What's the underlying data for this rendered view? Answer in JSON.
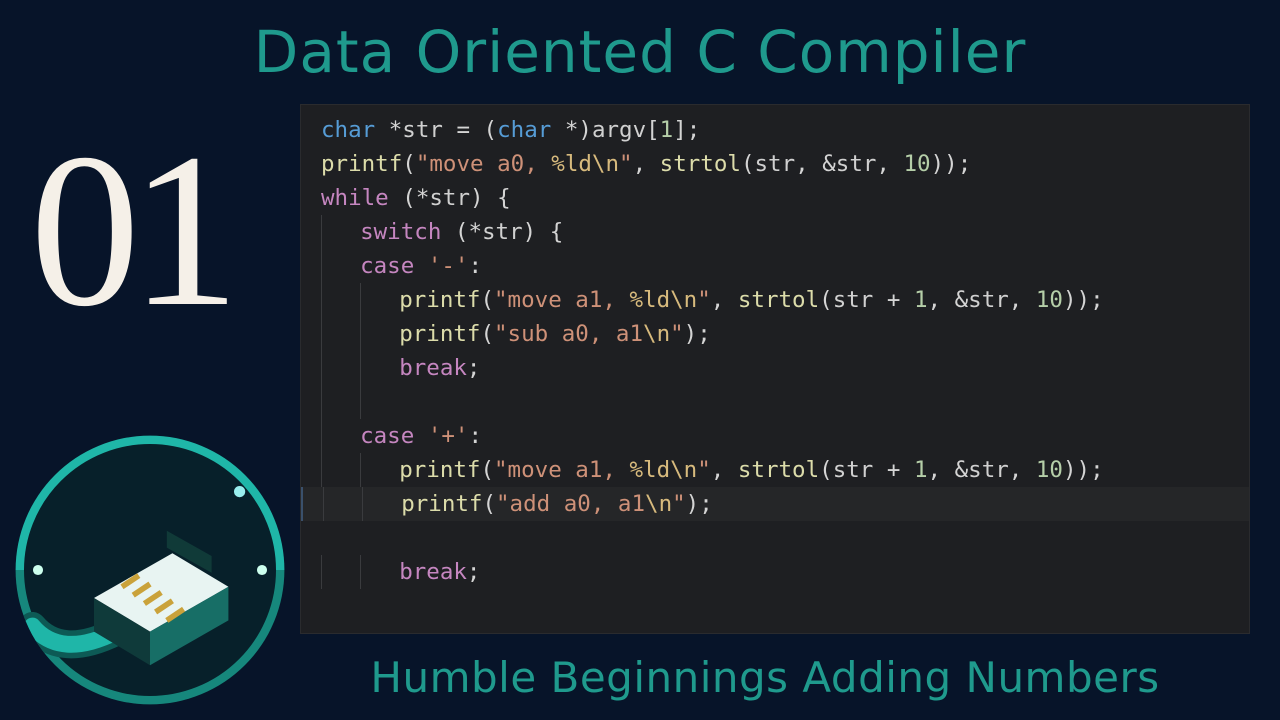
{
  "title": "Data Oriented C Compiler",
  "subtitle": "Humble Beginnings Adding Numbers",
  "episode": "01",
  "logo": {
    "name": "channel-logo"
  },
  "colors": {
    "bg": "#071429",
    "accent": "#1f9a8d",
    "code_bg": "#1e1f22"
  },
  "code": {
    "language": "c",
    "lines": [
      {
        "indent": 0,
        "tokens": [
          {
            "t": "type",
            "v": "char"
          },
          {
            "t": "op",
            "v": " *"
          },
          {
            "t": "id",
            "v": "str"
          },
          {
            "t": "op",
            "v": " = ("
          },
          {
            "t": "type",
            "v": "char"
          },
          {
            "t": "op",
            "v": " *)"
          },
          {
            "t": "id",
            "v": "argv"
          },
          {
            "t": "punc",
            "v": "["
          },
          {
            "t": "num",
            "v": "1"
          },
          {
            "t": "punc",
            "v": "];"
          }
        ]
      },
      {
        "indent": 0,
        "tokens": [
          {
            "t": "fn",
            "v": "printf"
          },
          {
            "t": "punc",
            "v": "("
          },
          {
            "t": "str",
            "v": "\"move a0, "
          },
          {
            "t": "esc",
            "v": "%ld\\n"
          },
          {
            "t": "str",
            "v": "\""
          },
          {
            "t": "punc",
            "v": ", "
          },
          {
            "t": "fn",
            "v": "strtol"
          },
          {
            "t": "punc",
            "v": "("
          },
          {
            "t": "id",
            "v": "str"
          },
          {
            "t": "punc",
            "v": ", "
          },
          {
            "t": "amp",
            "v": "&"
          },
          {
            "t": "id",
            "v": "str"
          },
          {
            "t": "punc",
            "v": ", "
          },
          {
            "t": "num",
            "v": "10"
          },
          {
            "t": "punc",
            "v": "));"
          }
        ]
      },
      {
        "indent": 0,
        "tokens": [
          {
            "t": "kw",
            "v": "while"
          },
          {
            "t": "punc",
            "v": " (*"
          },
          {
            "t": "id",
            "v": "str"
          },
          {
            "t": "punc",
            "v": ") {"
          }
        ]
      },
      {
        "indent": 1,
        "tokens": [
          {
            "t": "kw",
            "v": "switch"
          },
          {
            "t": "punc",
            "v": " (*"
          },
          {
            "t": "id",
            "v": "str"
          },
          {
            "t": "punc",
            "v": ") {"
          }
        ]
      },
      {
        "indent": 1,
        "tokens": [
          {
            "t": "kw",
            "v": "case"
          },
          {
            "t": "punc",
            "v": " "
          },
          {
            "t": "str",
            "v": "'-'"
          },
          {
            "t": "punc",
            "v": ":"
          }
        ]
      },
      {
        "indent": 2,
        "tokens": [
          {
            "t": "fn",
            "v": "printf"
          },
          {
            "t": "punc",
            "v": "("
          },
          {
            "t": "str",
            "v": "\"move a1, "
          },
          {
            "t": "esc",
            "v": "%ld\\n"
          },
          {
            "t": "str",
            "v": "\""
          },
          {
            "t": "punc",
            "v": ", "
          },
          {
            "t": "fn",
            "v": "strtol"
          },
          {
            "t": "punc",
            "v": "("
          },
          {
            "t": "id",
            "v": "str"
          },
          {
            "t": "op",
            "v": " + "
          },
          {
            "t": "num",
            "v": "1"
          },
          {
            "t": "punc",
            "v": ", "
          },
          {
            "t": "amp",
            "v": "&"
          },
          {
            "t": "id",
            "v": "str"
          },
          {
            "t": "punc",
            "v": ", "
          },
          {
            "t": "num",
            "v": "10"
          },
          {
            "t": "punc",
            "v": "));"
          }
        ]
      },
      {
        "indent": 2,
        "tokens": [
          {
            "t": "fn",
            "v": "printf"
          },
          {
            "t": "punc",
            "v": "("
          },
          {
            "t": "str",
            "v": "\"sub a0, a1"
          },
          {
            "t": "esc",
            "v": "\\n"
          },
          {
            "t": "str",
            "v": "\""
          },
          {
            "t": "punc",
            "v": ");"
          }
        ]
      },
      {
        "indent": 2,
        "tokens": [
          {
            "t": "kw",
            "v": "break"
          },
          {
            "t": "punc",
            "v": ";"
          }
        ]
      },
      {
        "indent": 2,
        "tokens": []
      },
      {
        "indent": 1,
        "tokens": [
          {
            "t": "kw",
            "v": "case"
          },
          {
            "t": "punc",
            "v": " "
          },
          {
            "t": "str",
            "v": "'+'"
          },
          {
            "t": "punc",
            "v": ":"
          }
        ]
      },
      {
        "indent": 2,
        "tokens": [
          {
            "t": "fn",
            "v": "printf"
          },
          {
            "t": "punc",
            "v": "("
          },
          {
            "t": "str",
            "v": "\"move a1, "
          },
          {
            "t": "esc",
            "v": "%ld\\n"
          },
          {
            "t": "str",
            "v": "\""
          },
          {
            "t": "punc",
            "v": ", "
          },
          {
            "t": "fn",
            "v": "strtol"
          },
          {
            "t": "punc",
            "v": "("
          },
          {
            "t": "id",
            "v": "str"
          },
          {
            "t": "op",
            "v": " + "
          },
          {
            "t": "num",
            "v": "1"
          },
          {
            "t": "punc",
            "v": ", "
          },
          {
            "t": "amp",
            "v": "&"
          },
          {
            "t": "id",
            "v": "str"
          },
          {
            "t": "punc",
            "v": ", "
          },
          {
            "t": "num",
            "v": "10"
          },
          {
            "t": "punc",
            "v": "));"
          }
        ]
      },
      {
        "indent": 2,
        "highlight": true,
        "tokens": [
          {
            "t": "fn",
            "v": "printf"
          },
          {
            "t": "punc",
            "v": "("
          },
          {
            "t": "str",
            "v": "\"add a0, a1"
          },
          {
            "t": "esc",
            "v": "\\n"
          },
          {
            "t": "str",
            "v": "\""
          },
          {
            "t": "punc",
            "v": ");"
          }
        ]
      },
      {
        "indent": 2,
        "tokens": [
          {
            "t": "kw",
            "v": "break"
          },
          {
            "t": "punc",
            "v": ";"
          }
        ]
      }
    ]
  }
}
